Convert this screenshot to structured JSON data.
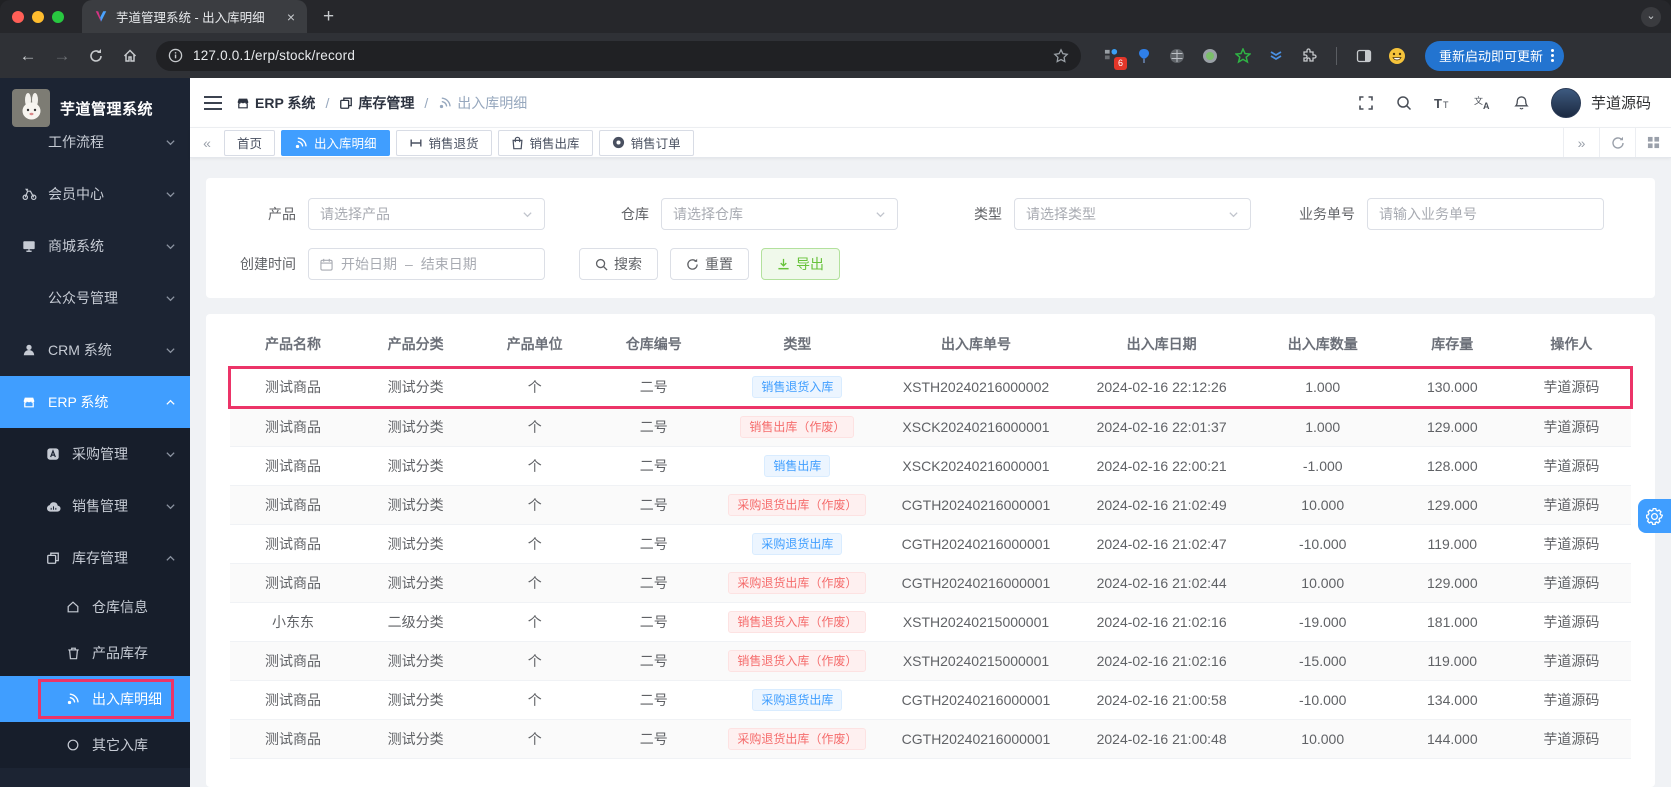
{
  "colors": {
    "accent": "#409eff",
    "annotation": "#ec3468",
    "success": "#67c23a",
    "danger": "#f56c6c",
    "sidebar_bg": "#1c2433"
  },
  "browser": {
    "tab_title": "芋道管理系统 - 出入库明细",
    "url": "127.0.0.1/erp/stock/record",
    "update_button_label": "重新启动即可更新",
    "extension_badge_count": "6",
    "extension_icons": [
      "extension-blocks-icon",
      "balloon-extension-icon",
      "dark-globe-extension-icon",
      "green-circle-extension-icon",
      "green-star-extension-icon",
      "blue-chevrons-extension-icon",
      "extensions-puzzle-icon",
      "side-panel-icon",
      "profile-emoji-icon"
    ]
  },
  "sidebar": {
    "app_title": "芋道管理系统",
    "menu": [
      {
        "label": "工作流程",
        "icon": "",
        "level": 1,
        "chevron": "down",
        "first": true
      },
      {
        "label": "会员中心",
        "icon": "member-icon",
        "level": 1,
        "chevron": "down"
      },
      {
        "label": "商城系统",
        "icon": "mall-icon",
        "level": 1,
        "chevron": "down"
      },
      {
        "label": "公众号管理",
        "icon": "",
        "level": 1,
        "chevron": "down"
      },
      {
        "label": "CRM 系统",
        "icon": "crm-icon",
        "level": 1,
        "chevron": "down"
      },
      {
        "label": "ERP 系统",
        "icon": "erp-icon",
        "level": 1,
        "chevron": "up",
        "active": true
      },
      {
        "label": "采购管理",
        "icon": "purchase-icon",
        "level": 2,
        "chevron": "down"
      },
      {
        "label": "销售管理",
        "icon": "sale-icon",
        "level": 2,
        "chevron": "down"
      },
      {
        "label": "库存管理",
        "icon": "stock-icon",
        "level": 2,
        "chevron": "up"
      },
      {
        "label": "仓库信息",
        "icon": "warehouse-icon",
        "level": 3
      },
      {
        "label": "产品库存",
        "icon": "product-stock-icon",
        "level": 3
      },
      {
        "label": "出入库明细",
        "icon": "record-icon",
        "level": 3,
        "active": true,
        "annotated": true
      },
      {
        "label": "其它入库",
        "icon": "other-in-icon",
        "level": 3
      }
    ]
  },
  "header": {
    "breadcrumb": [
      {
        "label": "ERP 系统",
        "icon": "erp-icon"
      },
      {
        "label": "库存管理",
        "icon": "stock-icon"
      },
      {
        "label": "出入库明细",
        "icon": "record-icon"
      }
    ],
    "action_icons": [
      "fullscreen-icon",
      "search-icon",
      "font-size-icon",
      "translate-icon",
      "bell-icon"
    ],
    "username": "芋道源码"
  },
  "tabbar": {
    "tabs": [
      {
        "label": "首页"
      },
      {
        "label": "出入库明细",
        "icon": "record-icon",
        "active": true
      },
      {
        "label": "销售退货",
        "icon": "return-icon"
      },
      {
        "label": "销售出库",
        "icon": "outbound-icon"
      },
      {
        "label": "销售订单",
        "icon": "order-icon"
      }
    ],
    "right_icons": [
      "expand-right-icon",
      "refresh-icon",
      "grid-icon"
    ]
  },
  "filters": {
    "product_label": "产品",
    "product_placeholder": "请选择产品",
    "warehouse_label": "仓库",
    "warehouse_placeholder": "请选择仓库",
    "type_label": "类型",
    "type_placeholder": "请选择类型",
    "biz_no_label": "业务单号",
    "biz_no_placeholder": "请输入业务单号",
    "create_time_label": "创建时间",
    "date_start_placeholder": "开始日期",
    "date_separator": "–",
    "date_end_placeholder": "结束日期",
    "search_label": "搜索",
    "reset_label": "重置",
    "export_label": "导出"
  },
  "table": {
    "columns": [
      "产品名称",
      "产品分类",
      "产品单位",
      "仓库编号",
      "类型",
      "出入库单号",
      "出入库日期",
      "出入库数量",
      "库存量",
      "操作人"
    ],
    "rows": [
      {
        "product": "测试商品",
        "category": "测试分类",
        "unit": "个",
        "warehouse": "二号",
        "type": "销售退货入库",
        "type_color": "blue",
        "no": "XSTH20240216000002",
        "date": "2024-02-16 22:12:26",
        "qty": "1.000",
        "stock": "130.000",
        "operator": "芋道源码",
        "annotated": true
      },
      {
        "product": "测试商品",
        "category": "测试分类",
        "unit": "个",
        "warehouse": "二号",
        "type": "销售出库（作废）",
        "type_color": "red",
        "no": "XSCK20240216000001",
        "date": "2024-02-16 22:01:37",
        "qty": "1.000",
        "stock": "129.000",
        "operator": "芋道源码"
      },
      {
        "product": "测试商品",
        "category": "测试分类",
        "unit": "个",
        "warehouse": "二号",
        "type": "销售出库",
        "type_color": "blue",
        "no": "XSCK20240216000001",
        "date": "2024-02-16 22:00:21",
        "qty": "-1.000",
        "stock": "128.000",
        "operator": "芋道源码"
      },
      {
        "product": "测试商品",
        "category": "测试分类",
        "unit": "个",
        "warehouse": "二号",
        "type": "采购退货出库（作废）",
        "type_color": "red",
        "no": "CGTH20240216000001",
        "date": "2024-02-16 21:02:49",
        "qty": "10.000",
        "stock": "129.000",
        "operator": "芋道源码"
      },
      {
        "product": "测试商品",
        "category": "测试分类",
        "unit": "个",
        "warehouse": "二号",
        "type": "采购退货出库",
        "type_color": "blue",
        "no": "CGTH20240216000001",
        "date": "2024-02-16 21:02:47",
        "qty": "-10.000",
        "stock": "119.000",
        "operator": "芋道源码"
      },
      {
        "product": "测试商品",
        "category": "测试分类",
        "unit": "个",
        "warehouse": "二号",
        "type": "采购退货出库（作废）",
        "type_color": "red",
        "no": "CGTH20240216000001",
        "date": "2024-02-16 21:02:44",
        "qty": "10.000",
        "stock": "129.000",
        "operator": "芋道源码"
      },
      {
        "product": "小东东",
        "category": "二级分类",
        "unit": "个",
        "warehouse": "二号",
        "type": "销售退货入库（作废）",
        "type_color": "red",
        "no": "XSTH20240215000001",
        "date": "2024-02-16 21:02:16",
        "qty": "-19.000",
        "stock": "181.000",
        "operator": "芋道源码"
      },
      {
        "product": "测试商品",
        "category": "测试分类",
        "unit": "个",
        "warehouse": "二号",
        "type": "销售退货入库（作废）",
        "type_color": "red",
        "no": "XSTH20240215000001",
        "date": "2024-02-16 21:02:16",
        "qty": "-15.000",
        "stock": "119.000",
        "operator": "芋道源码"
      },
      {
        "product": "测试商品",
        "category": "测试分类",
        "unit": "个",
        "warehouse": "二号",
        "type": "采购退货出库",
        "type_color": "blue",
        "no": "CGTH20240216000001",
        "date": "2024-02-16 21:00:58",
        "qty": "-10.000",
        "stock": "134.000",
        "operator": "芋道源码"
      },
      {
        "product": "测试商品",
        "category": "测试分类",
        "unit": "个",
        "warehouse": "二号",
        "type": "采购退货出库（作废）",
        "type_color": "red",
        "no": "CGTH20240216000001",
        "date": "2024-02-16 21:00:48",
        "qty": "10.000",
        "stock": "144.000",
        "operator": "芋道源码"
      }
    ]
  }
}
